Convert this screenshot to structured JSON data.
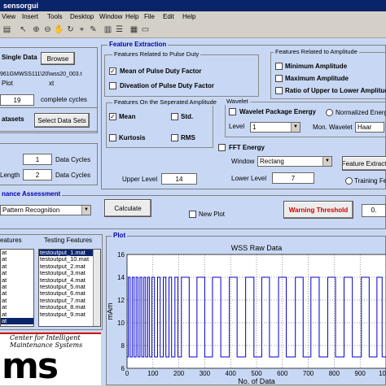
{
  "window": {
    "title": "sensorgui"
  },
  "menu": [
    "View",
    "Insert",
    "Tools",
    "Desktop",
    "Window",
    "Help",
    "File",
    "Edit",
    "Help"
  ],
  "toolbar_icons": [
    "print-icon",
    "pointer-icon",
    "zoom-in-icon",
    "zoom-out-icon",
    "pan-icon",
    "rotate-icon",
    "data-cursor-icon",
    "brush-icon",
    "colorbar-icon",
    "legend-icon",
    "grid-icon",
    "hide-icon"
  ],
  "left_panel": {
    "single_data_label": "Single Data",
    "browse": "Browse",
    "path_text": "961GMWSS111\\20\\wss20_003.t",
    "plot_label": "Plot",
    "ext_label": "xt",
    "cycles_value": "19",
    "cycles_label": "complete cycles",
    "datasets_label": "atasets",
    "select_datasets": "Select Data Sets",
    "data_cycles_value": "1",
    "data_cycles_label": "Data Cycles",
    "length_label": "Length",
    "length_value": "2",
    "length_cycles_label": "Data Cycles"
  },
  "feature_extraction": {
    "title": "Feature Extraction",
    "pulse_duty": {
      "title": "Features Related to Pulse Duty",
      "mean_label": "Mean of Pulse Duty Factor",
      "mean_checked": true,
      "deviation_label": "Diveation of Pulse Duty Factor",
      "deviation_checked": false
    },
    "amplitude": {
      "title": "Features Related to Amplitude",
      "min_label": "Minimum Amplitude",
      "max_label": "Maximum Amplitude",
      "ratio_label": "Ratio of Upper to Lower Amplitude"
    },
    "separated": {
      "title": "Features On the Seperated Amplitude",
      "mean_label": "Mean",
      "mean_checked": true,
      "std_label": "Std.",
      "kurtosis_label": "Kurtosis",
      "rms_label": "RMS"
    },
    "wavelet": {
      "title": "Wavelet",
      "package_label": "Wavelet Package Energy",
      "normalized_label": "Normalized Energy",
      "level_label": "Level",
      "level_value": "1",
      "mon_label": "Mon. Wavelet",
      "mon_value": "Haar"
    },
    "fft": {
      "label": "FFT Energy",
      "window_label": "Window",
      "window_value": "Rectang",
      "feature_extract_button": "Feature Extracti",
      "training_label": "Training Feat"
    },
    "upper_level_label": "Upper Level",
    "upper_level_value": "14",
    "lower_level_label": "Lower Level",
    "lower_level_value": "7"
  },
  "assessment": {
    "title": "nance Assessment",
    "method_value": "Pattern Recognition",
    "calculate": "Calculate",
    "new_plot": "New Plot",
    "warning_button": "Warning Threshold",
    "threshold_value": "0."
  },
  "features_panel": {
    "training_label": "eatures",
    "testing_label": "Testing Features",
    "training_items": [
      "at",
      "at",
      "at",
      "at",
      "at",
      "at",
      "at",
      "at",
      "at",
      "at",
      "at",
      "at"
    ],
    "testing_items": [
      "testoutput_1.mat",
      "testoutput_10.mat",
      "testoutput_2.mat",
      "testoutput_3.mat",
      "testoutput_4.mat",
      "testoutput_5.mat",
      "testoutput_6.mat",
      "testoutput_7.mat",
      "testoutput_8.mat",
      "testoutput_9.mat"
    ]
  },
  "plot_panel": {
    "title": "Plot"
  },
  "logo": {
    "line1": "Center for Intelligent",
    "line2": "Maintenance Systems",
    "big": "ms"
  },
  "chart_data": {
    "type": "line",
    "title": "WSS Raw Data",
    "xlabel": "No. of Data",
    "ylabel": "mAm",
    "xlim": [
      0,
      1000
    ],
    "ylim": [
      6,
      16
    ],
    "xticks": [
      0,
      100,
      200,
      300,
      400,
      500,
      600,
      700,
      800,
      900,
      1000
    ],
    "yticks": [
      6,
      8,
      10,
      12,
      14,
      16
    ],
    "grid": true,
    "color": "#0000cc",
    "high": 14,
    "low": 7,
    "pulses": [
      [
        5,
        12
      ],
      [
        20,
        27
      ],
      [
        35,
        42
      ],
      [
        50,
        57
      ],
      [
        65,
        72
      ],
      [
        80,
        87
      ],
      [
        96,
        106
      ],
      [
        118,
        128
      ],
      [
        140,
        150
      ],
      [
        162,
        172
      ],
      [
        185,
        196
      ],
      [
        210,
        240
      ],
      [
        270,
        300
      ],
      [
        330,
        362
      ],
      [
        395,
        425
      ],
      [
        458,
        490
      ],
      [
        520,
        550
      ],
      [
        585,
        615
      ],
      [
        650,
        680
      ],
      [
        710,
        742
      ],
      [
        775,
        805
      ],
      [
        838,
        870
      ],
      [
        905,
        935
      ],
      [
        965,
        985
      ]
    ]
  }
}
